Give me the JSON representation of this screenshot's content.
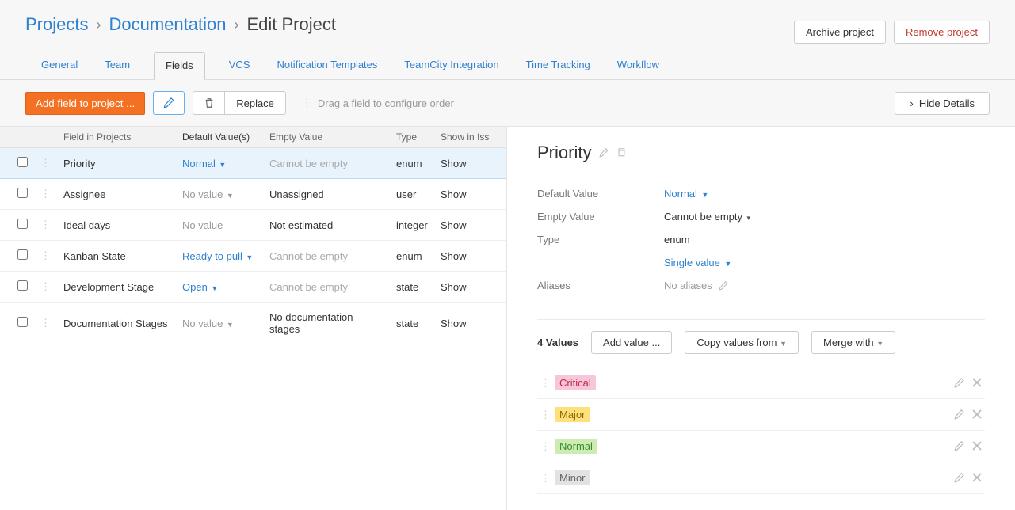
{
  "breadcrumb": {
    "projects": "Projects",
    "documentation": "Documentation",
    "current": "Edit Project"
  },
  "header_actions": {
    "archive": "Archive project",
    "remove": "Remove project"
  },
  "tabs": {
    "general": "General",
    "team": "Team",
    "fields": "Fields",
    "vcs": "VCS",
    "notification": "Notification Templates",
    "teamcity": "TeamCity Integration",
    "time_tracking": "Time Tracking",
    "workflow": "Workflow"
  },
  "toolbar": {
    "add_field": "Add field to project ...",
    "replace": "Replace",
    "hint": "Drag a field to configure order",
    "hide_details": "Hide Details"
  },
  "table": {
    "headers": {
      "field": "Field in Projects",
      "default": "Default Value(s)",
      "empty": "Empty Value",
      "type": "Type",
      "show": "Show in Iss"
    },
    "rows": [
      {
        "name": "Priority",
        "default": "Normal",
        "default_link": true,
        "empty": "Cannot be empty",
        "empty_muted": true,
        "type": "enum",
        "show": "Show",
        "selected": true
      },
      {
        "name": "Assignee",
        "default": "No value",
        "default_link": true,
        "default_muted": true,
        "empty": "Unassigned",
        "empty_muted": false,
        "type": "user",
        "show": "Show",
        "selected": false
      },
      {
        "name": "Ideal days",
        "default": "No value",
        "default_link": false,
        "default_muted": true,
        "empty": "Not estimated",
        "empty_muted": false,
        "type": "integer",
        "show": "Show",
        "selected": false
      },
      {
        "name": "Kanban State",
        "default": "Ready to pull",
        "default_link": true,
        "empty": "Cannot be empty",
        "empty_muted": true,
        "type": "enum",
        "show": "Show",
        "selected": false
      },
      {
        "name": "Development Stage",
        "default": "Open",
        "default_link": true,
        "empty": "Cannot be empty",
        "empty_muted": true,
        "type": "state",
        "show": "Show",
        "selected": false
      },
      {
        "name": "Documentation Stages",
        "default": "No value",
        "default_link": true,
        "default_muted": true,
        "empty": "No documentation stages",
        "empty_muted": false,
        "type": "state",
        "show": "Show",
        "selected": false
      }
    ]
  },
  "panel": {
    "title": "Priority",
    "props": {
      "default_label": "Default Value",
      "default_value": "Normal",
      "empty_label": "Empty Value",
      "empty_value": "Cannot be empty",
      "type_label": "Type",
      "type_value": "enum",
      "type_extra": "Single value",
      "aliases_label": "Aliases",
      "aliases_value": "No aliases"
    },
    "values": {
      "count_label": "4 Values",
      "add": "Add value ...",
      "copy": "Copy values from",
      "merge": "Merge with",
      "items": [
        {
          "label": "Critical",
          "bg": "#f7c7d9",
          "fg": "#c0284a"
        },
        {
          "label": "Major",
          "bg": "#ffe07a",
          "fg": "#8a6d00"
        },
        {
          "label": "Normal",
          "bg": "#ccecb4",
          "fg": "#3d8b2b"
        },
        {
          "label": "Minor",
          "bg": "#e2e2e2",
          "fg": "#666"
        }
      ]
    }
  }
}
